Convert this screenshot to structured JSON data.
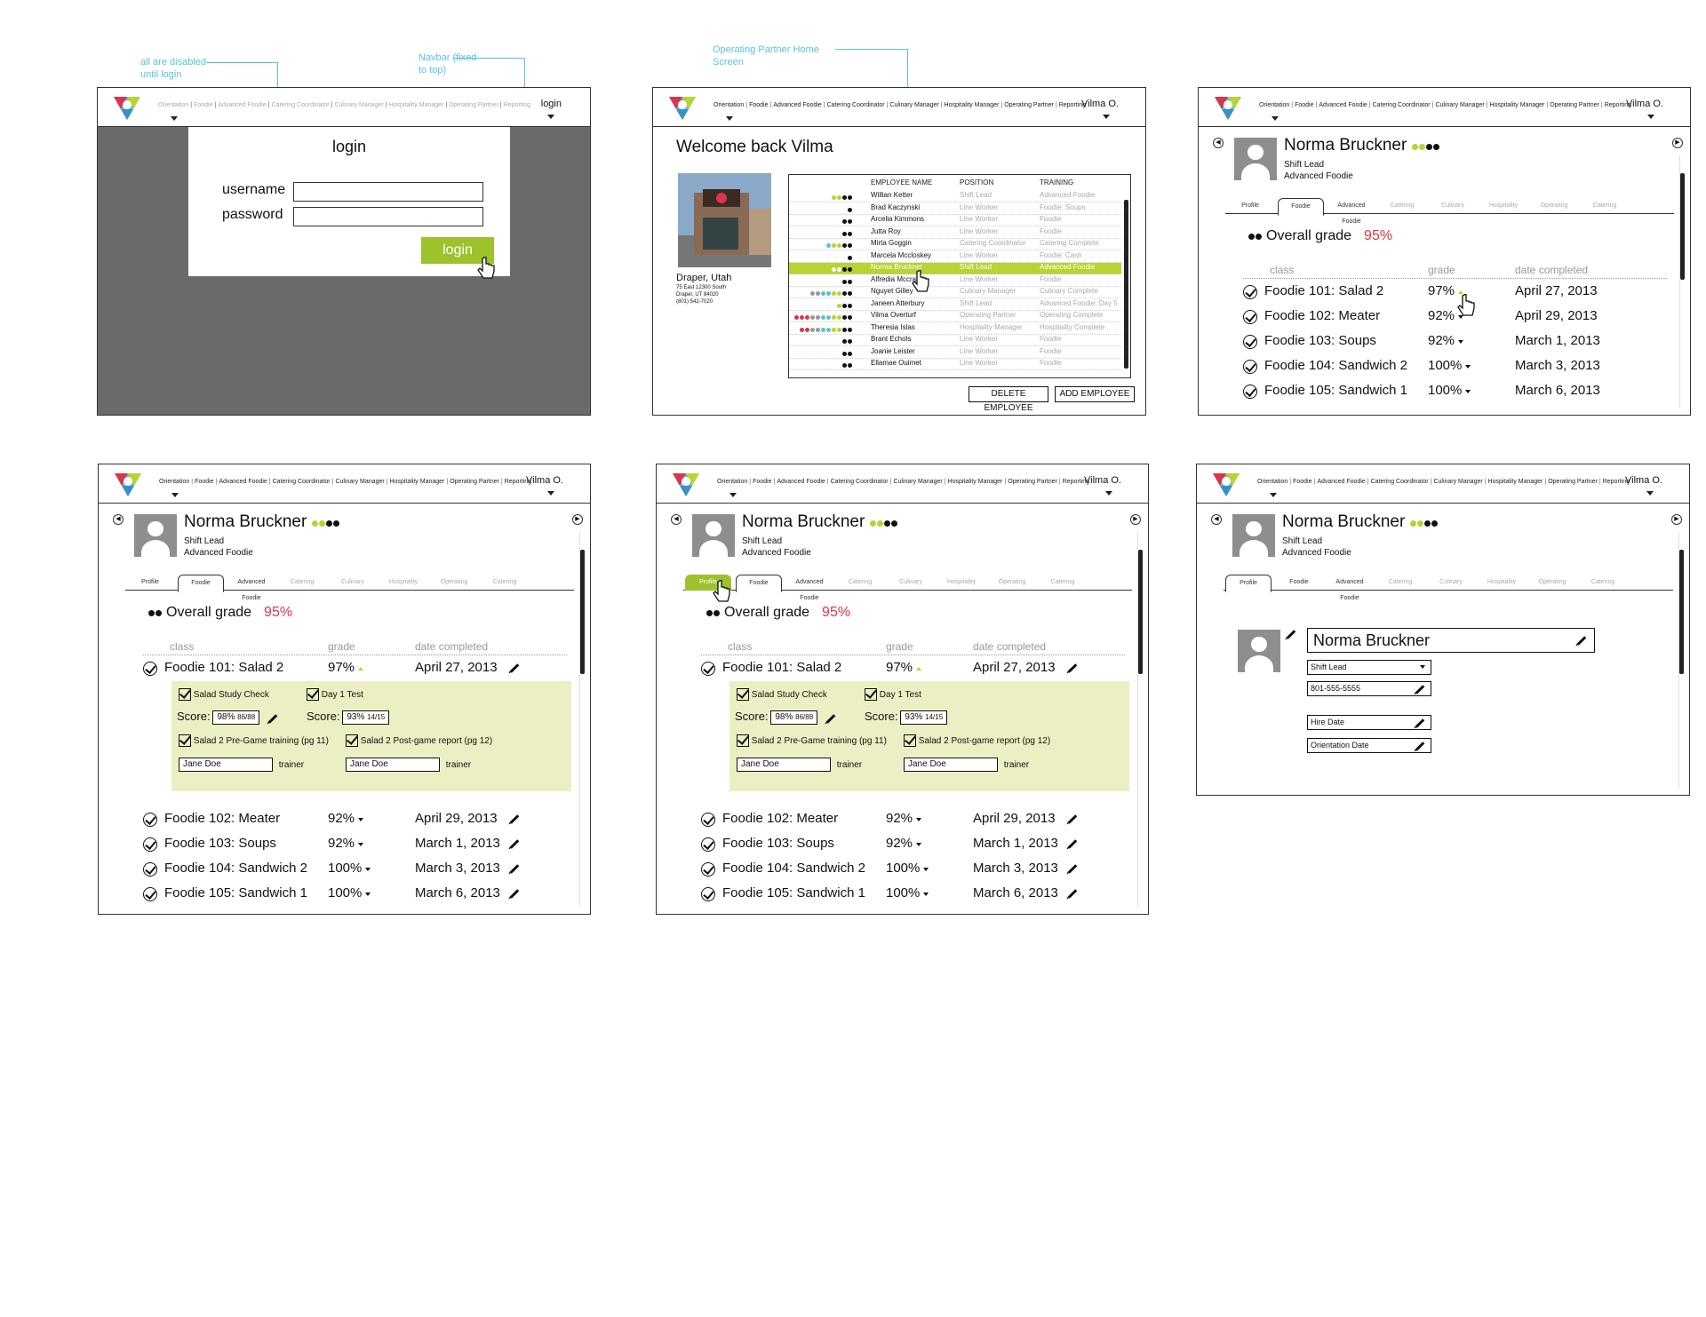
{
  "annotations": {
    "disabled_note": "all are disabled until login",
    "navbar_note": "Navbar (fixed to top)",
    "home_note": "Operating Partner Home Screen"
  },
  "nav": {
    "links": [
      "Orientation",
      "Foodie",
      "Advanced Foodie",
      "Catering Coordinator",
      "Culinary Manager",
      "Hospitality Manager",
      "Operating Partner",
      "Reporting"
    ],
    "login_label": "login",
    "user": "Vilma O."
  },
  "login": {
    "title": "login",
    "username_label": "username",
    "password_label": "password",
    "username_value": "",
    "password_value": "",
    "button": "login"
  },
  "home": {
    "welcome": "Welcome back  Vilma",
    "location": {
      "city": "Draper, Utah",
      "address1": "75 East 12300 South",
      "address2": "Draper, UT 84020",
      "phone": "(801) 542-7020"
    },
    "columns": [
      "EMPLOYEE NAME",
      "POSITION",
      "TRAINING"
    ],
    "employees": [
      {
        "name": "Willian Ketter",
        "position": "Shift Lead",
        "training": "Advanced Foodie",
        "dots": [
          "#b7d433",
          "#b7d433",
          "#111",
          "#111"
        ]
      },
      {
        "name": "Brad Kaczynski",
        "position": "Line Worker",
        "training": "Foodie: Soups",
        "dots": [
          "#111"
        ]
      },
      {
        "name": "Arcelia Kimmons",
        "position": "Line Worker",
        "training": "Foodie",
        "dots": [
          "#111",
          "#111"
        ]
      },
      {
        "name": "Jutta Roy",
        "position": "Line Worker",
        "training": "Foodie",
        "dots": [
          "#111",
          "#111"
        ]
      },
      {
        "name": "Mirta Goggin",
        "position": "Catering Coordinator",
        "training": "Catering Complete",
        "dots": [
          "#5bc0de",
          "#b7d433",
          "#b7d433",
          "#111",
          "#111"
        ]
      },
      {
        "name": "Marcela Mccloskey",
        "position": "Line Worker",
        "training": "Foodie: Cash",
        "dots": [
          "#111"
        ]
      },
      {
        "name": "Norma Bruckner",
        "position": "Shift Lead",
        "training": "Advanced Foodie",
        "dots": [
          "#b7d433",
          "#b7d433",
          "#111",
          "#111"
        ],
        "selected": true
      },
      {
        "name": "Alfredia Mccray",
        "position": "Line Worker",
        "training": "Foodie",
        "dots": [
          "#111",
          "#111"
        ]
      },
      {
        "name": "Nguyet Gilley",
        "position": "Culinary Manager",
        "training": "Culinary Complete",
        "dots": [
          "#999",
          "#999",
          "#5bc0de",
          "#5bc0de",
          "#b7d433",
          "#b7d433",
          "#111",
          "#111"
        ]
      },
      {
        "name": "Janeen Atterbury",
        "position": "Shift Lead",
        "training": "Advanced Foodie: Day 5",
        "dots": [
          "#b7d433",
          "#111",
          "#111"
        ]
      },
      {
        "name": "Vilma Overturf",
        "position": "Operating Partner",
        "training": "Operating Complete",
        "dots": [
          "#d9354b",
          "#d9354b",
          "#d9354b",
          "#999",
          "#999",
          "#5bc0de",
          "#5bc0de",
          "#b7d433",
          "#b7d433",
          "#111",
          "#111"
        ]
      },
      {
        "name": "Theresia Islas",
        "position": "Hospitality Manager",
        "training": "Hospitality Complete",
        "dots": [
          "#d9354b",
          "#d9354b",
          "#999",
          "#999",
          "#5bc0de",
          "#5bc0de",
          "#b7d433",
          "#b7d433",
          "#111",
          "#111"
        ]
      },
      {
        "name": "Brant Echols",
        "position": "Line Worker",
        "training": "Foodie",
        "dots": [
          "#111",
          "#111"
        ]
      },
      {
        "name": "Joanie Leister",
        "position": "Line Worker",
        "training": "Foodie",
        "dots": [
          "#111",
          "#111"
        ]
      },
      {
        "name": "Ellamae Ouimet",
        "position": "Line Worker",
        "training": "Foodie",
        "dots": [
          "#111",
          "#111"
        ]
      }
    ],
    "delete_btn": "DELETE EMPLOYEE",
    "add_btn": "ADD EMPLOYEE"
  },
  "profile": {
    "name": "Norma Bruckner",
    "title": "Shift Lead",
    "level": "Advanced Foodie",
    "tabs": [
      "Profile",
      "Foodie",
      "Advanced Foodie",
      "Catering",
      "Culinary",
      "Hospitality",
      "Operating",
      "Catering"
    ],
    "overall_label": "Overall grade",
    "overall_value": "95%",
    "col_class": "class",
    "col_grade": "grade",
    "col_date": "date completed",
    "classes": [
      {
        "name": "Foodie 101: Salad 2",
        "grade": "97%",
        "date": "April 27, 2013"
      },
      {
        "name": "Foodie 102: Meater",
        "grade": "92%",
        "date": "April 29, 2013"
      },
      {
        "name": "Foodie 103: Soups",
        "grade": "92%",
        "date": "March 1, 2013"
      },
      {
        "name": "Foodie 104: Sandwich 2",
        "grade": "100%",
        "date": "March 3, 2013"
      },
      {
        "name": "Foodie 105: Sandwich 1",
        "grade": "100%",
        "date": "March 6, 2013"
      }
    ],
    "detail": {
      "study_check": "Salad Study Check",
      "day1_test": "Day 1 Test",
      "score_label": "Score:",
      "score1": "98%",
      "score1_frac": "86/88",
      "score2": "93%",
      "score2_frac": "14/15",
      "pregame": "Salad 2 Pre-Game training (pg 11)",
      "postgame": "Salad 2 Post-game report (pg 12)",
      "trainer1": "Jane Doe",
      "trainer2": "Jane Doe",
      "trainer_label": "trainer"
    },
    "edit": {
      "name": "Norma Bruckner",
      "position": "Shift Lead",
      "phone": "801-555-5555",
      "hire_date": "Hire Date",
      "orientation_date": "Orientation Date"
    }
  },
  "colors": {
    "accent": "#9dc22c",
    "annotation": "#5bc0de",
    "grade": "#d9354b",
    "overlay": "#6b6b6b",
    "highlight_panel": "#ecefc3"
  }
}
